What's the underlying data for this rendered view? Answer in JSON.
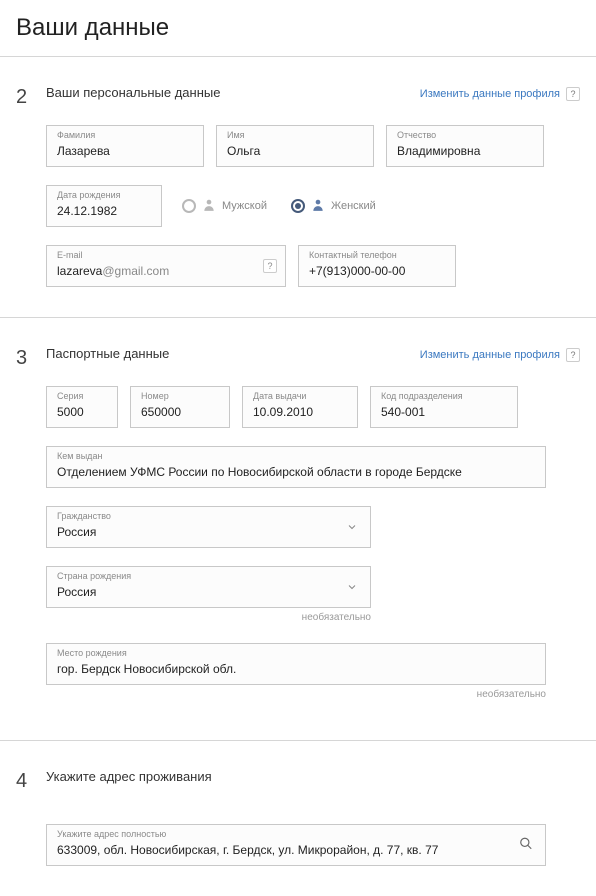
{
  "page_title": "Ваши данные",
  "sections": {
    "s2": {
      "num": "2",
      "title": "Ваши персональные данные",
      "edit_link": "Изменить данные профиля",
      "help": "?",
      "surname_lbl": "Фамилия",
      "surname_val": "Лазарева",
      "name_lbl": "Имя",
      "name_val": "Ольга",
      "patr_lbl": "Отчество",
      "patr_val": "Владимировна",
      "dob_lbl": "Дата рождения",
      "dob_val": "24.12.1982",
      "gender_male": "Мужской",
      "gender_female": "Женский",
      "email_lbl": "E-mail",
      "email_user": "lazareva",
      "email_domain": "@gmail.com",
      "phone_lbl": "Контактный телефон",
      "phone_val": "+7(913)000-00-00"
    },
    "s3": {
      "num": "3",
      "title": "Паспортные данные",
      "edit_link": "Изменить данные профиля",
      "help": "?",
      "series_lbl": "Серия",
      "series_val": "5000",
      "number_lbl": "Номер",
      "number_val": "650000",
      "issue_date_lbl": "Дата выдачи",
      "issue_date_val": "10.09.2010",
      "dept_code_lbl": "Код подразделения",
      "dept_code_val": "540-001",
      "issued_by_lbl": "Кем выдан",
      "issued_by_val": "Отделением УФМС России по Новосибирской области в городе Бердске",
      "citizenship_lbl": "Гражданство",
      "citizenship_val": "Россия",
      "birth_country_lbl": "Страна рождения",
      "birth_country_val": "Россия",
      "optional": "необязательно",
      "birth_place_lbl": "Место рождения",
      "birth_place_val": "гор. Бердск Новосибирской обл."
    },
    "s4": {
      "num": "4",
      "title": "Укажите адрес проживания",
      "addr_lbl": "Укажите адрес полностью",
      "addr_val": "633009, обл. Новосибирская, г. Бердск, ул. Микрорайон, д. 77, кв. 77"
    }
  }
}
